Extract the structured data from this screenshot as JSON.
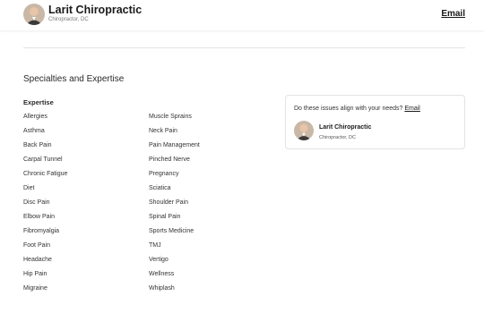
{
  "header": {
    "name": "Larit Chiropractic",
    "subtitle": "Chiropractor, DC",
    "email_label": "Email"
  },
  "section": {
    "title": "Specialties and Expertise",
    "expertise_label": "Expertise"
  },
  "expertise": {
    "col1": [
      "Allergies",
      "Asthma",
      "Back Pain",
      "Carpal Tunnel",
      "Chronic Fatigue",
      "Diet",
      "Disc Pain",
      "Elbow Pain",
      "Fibromyalgia",
      "Foot Pain",
      "Headache",
      "Hip Pain",
      "Migraine"
    ],
    "col2": [
      "Muscle Sprains",
      "Neck Pain",
      "Pain Management",
      "Pinched Nerve",
      "Pregnancy",
      "Sciatica",
      "Shoulder Pain",
      "Spinal Pain",
      "Sports Medicine",
      "TMJ",
      "Vertigo",
      "Wellness",
      "Whiplash"
    ]
  },
  "card": {
    "question": "Do these issues align with your needs?",
    "email_label": "Email",
    "name": "Larit Chiropractic",
    "subtitle": "Chiropractor, DC"
  }
}
